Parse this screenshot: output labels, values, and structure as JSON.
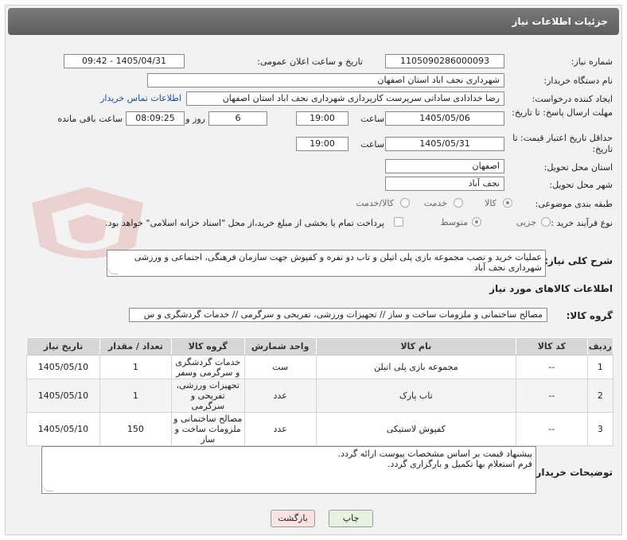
{
  "header": {
    "title": "جزئیات اطلاعات نیاز"
  },
  "fields": {
    "need_number_label": "شماره نیاز:",
    "need_number": "1105090286000093",
    "announce_label": "تاریخ و ساعت اعلان عمومی:",
    "announce_value": "1405/04/31 - 09:42",
    "buyer_org_label": "نام دستگاه خریدار:",
    "buyer_org": "شهرداری نجف اباد استان اصفهان",
    "requester_label": "ایجاد کننده درخواست:",
    "requester": "رضا خدادادی ساداتی سرپرست  کارپردازی شهرداری نجف اباد استان اصفهان",
    "contact_link": "اطلاعات تماس خریدار",
    "deadline_label": "مهلت ارسال پاسخ: تا تاریخ:",
    "deadline_date": "1405/05/06",
    "time_word": "ساعت",
    "deadline_time": "19:00",
    "days_value": "6",
    "days_word": "روز و",
    "remaining_time": "08:09:25",
    "remaining_word": "ساعت باقی مانده",
    "validity_label": "حداقل تاریخ اعتبار قیمت: تا تاریخ:",
    "validity_date": "1405/05/31",
    "validity_time": "19:00",
    "province_label": "استان محل تحویل:",
    "province": "اصفهان",
    "city_label": "شهر محل تحویل:",
    "city": "نجف آباد",
    "category_label": "طبقه بندی موضوعی:",
    "category_options": [
      "کالا",
      "خدمت",
      "کالا/خدمت"
    ],
    "process_label": "نوع فرآیند خرید :",
    "process_options": [
      "جزیی",
      "متوسط"
    ],
    "payment_note": "پرداخت تمام یا بخشی از مبلغ خرید،از محل \"اسناد خزانه اسلامی\" خواهد بود.",
    "description_label": "شرح کلی نیاز:",
    "description": "عملیات خرید و نصب مجموعه بازی پلی اتیلن و تاب دو نفره و کفپوش جهت سازمان فرهنگی، اجتماعی و ورزشی شهرداری نجف آباد",
    "goods_info_title": "اطلاعات کالاهای مورد نیاز",
    "goods_group_label": "گروه کالا:",
    "goods_group": "مصالح ساختمانی و ملزومات ساخت و ساز // تجهیزات ورزشی، تفریحی و سرگرمی // خدمات گردشگری و س",
    "buyer_notes_label": "توضیحات خریدار:",
    "buyer_notes_line1": "پیشنهاد قیمت بر اساس مشخصات پیوست ارائه گردد.",
    "buyer_notes_line2": "فرم استعلام بها تکمیل و بارگزاری گردد."
  },
  "table": {
    "headers": [
      "ردیف",
      "کد کالا",
      "نام کالا",
      "واحد شمارش",
      "گروه کالا",
      "تعداد / مقدار",
      "تاریخ نیاز"
    ],
    "rows": [
      [
        "1",
        "--",
        "مجموعه بازی پلی اتیلن",
        "ست",
        "خدمات گردشگری و سرگرمی وسفر",
        "1",
        "1405/05/10"
      ],
      [
        "2",
        "--",
        "تاب پارک",
        "عدد",
        "تجهیزات ورزشی، تفریحی و سرگرمی",
        "1",
        "1405/05/10"
      ],
      [
        "3",
        "--",
        "کفپوش لاستیکی",
        "عدد",
        "مصالح ساختمانی و ملزومات ساخت و ساز",
        "150",
        "1405/05/10"
      ]
    ]
  },
  "buttons": {
    "print": "چاپ",
    "back": "بازگشت"
  },
  "colors": {
    "header_bg": "#6b6b6b",
    "link": "#1a4fa0",
    "print_bg": "#e6f3e0",
    "back_bg": "#fbe3e3"
  }
}
